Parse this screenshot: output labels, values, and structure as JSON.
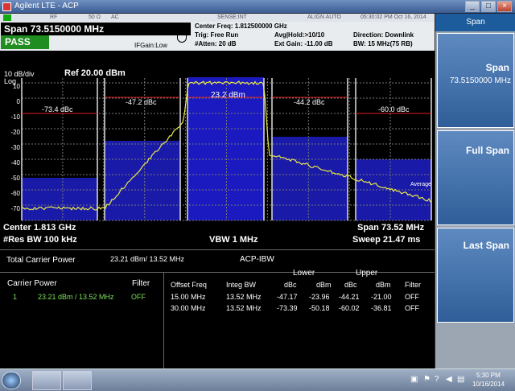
{
  "window": {
    "title": "Agilent LTE - ACP",
    "min": "_",
    "max": "□",
    "close": "×"
  },
  "status": {
    "input": "RF",
    "impedance": "50 Ω",
    "coupling": "AC",
    "sense": "SENSE:INT",
    "align": "ALIGN AUTO",
    "datetime": "05:30:02 PM Oct 16, 2014"
  },
  "header": {
    "span": "Span 73.5150000 MHz",
    "pass": "PASS",
    "center_freq": "Center Freq: 1.812500000 GHz",
    "trig": "Trig: Free Run",
    "atten": "#Atten: 20 dB",
    "avg_hold": "Avg|Hold:>10/10",
    "ext_gain": "Ext Gain: -11.00 dB",
    "direction": "Direction: Downlink",
    "bw": "BW: 15 MHz(75 RB)",
    "ifgain": "IFGain:Low"
  },
  "plot": {
    "scale": "10 dB/div",
    "log": "Log",
    "ref": "Ref 20.00 dBm",
    "yticks": [
      "10",
      "0",
      "-10",
      "-20",
      "-30",
      "-40",
      "-50",
      "-60",
      "-70"
    ],
    "dbc_labels": [
      "-73.4 dBc",
      "-47.2 dBc",
      "-44.2 dBc",
      "-60.0 dBc"
    ],
    "carrier": "23.2 dBm",
    "average": "Average",
    "colors": {
      "trace": "#e8e84a",
      "bars": "#1a1aa8",
      "carrier_bar": "#1a1ac0",
      "limit_line": "#e02020"
    }
  },
  "footer": {
    "center": "Center 1.813 GHz",
    "res_bw": "#Res BW 100 kHz",
    "vbw": "VBW 1 MHz",
    "span": "Span 73.52 MHz",
    "sweep": "Sweep 21.47 ms"
  },
  "results": {
    "total_label": "Total Carrier Power",
    "total_value": "23.21 dBm/ 13.52 MHz",
    "mode": "ACP-IBW",
    "carrier_label": "Carrier Power",
    "filter_label": "Filter",
    "carrier_row": {
      "index": "1",
      "power": "23.21 dBm /  13.52 MHz",
      "filter": "OFF"
    },
    "lower": "Lower",
    "upper": "Upper",
    "columns": [
      "Offset Freq",
      "Integ BW",
      "dBc",
      "dBm",
      "dBc",
      "dBm",
      "Filter"
    ],
    "rows": [
      [
        "15.00 MHz",
        "13.52 MHz",
        "-47.17",
        "-23.96",
        "-44.21",
        "-21.00",
        "OFF"
      ],
      [
        "30.00 MHz",
        "13.52 MHz",
        "-73.39",
        "-50.18",
        "-60.02",
        "-36.81",
        "OFF"
      ]
    ]
  },
  "softkeys": {
    "title": "Span",
    "keys": [
      {
        "label": "Span",
        "value": "73.5150000 MHz"
      },
      {
        "label": "Full Span",
        "value": ""
      },
      {
        "label": "Last Span",
        "value": ""
      }
    ]
  },
  "taskbar": {
    "time": "5:30 PM",
    "date": "10/16/2014"
  }
}
